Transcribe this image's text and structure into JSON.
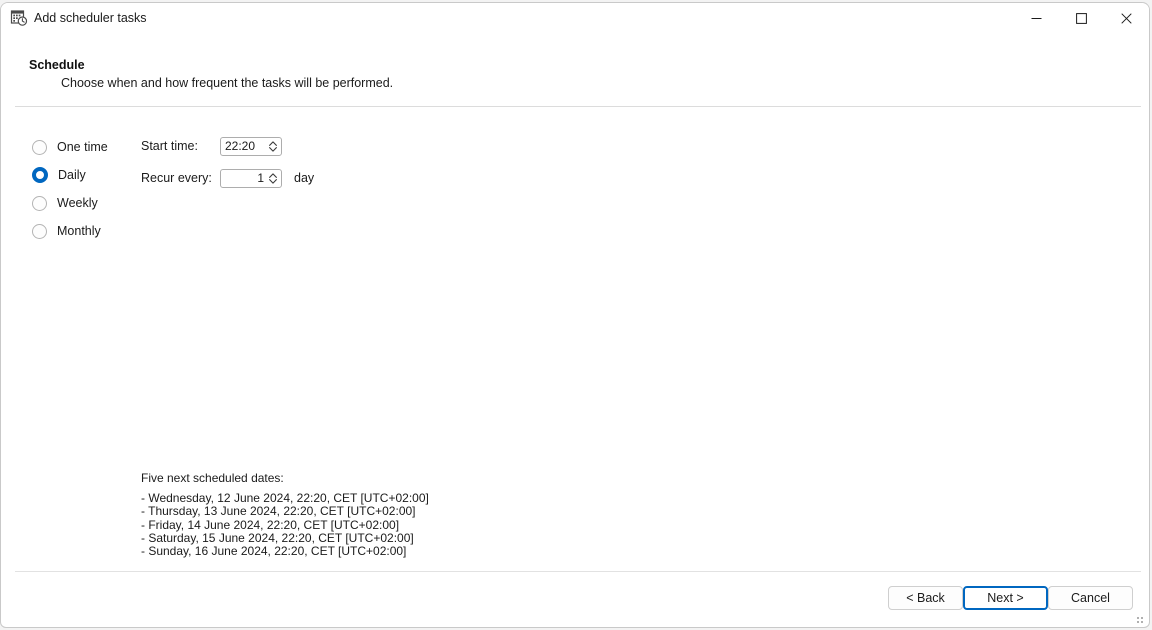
{
  "window": {
    "title": "Add scheduler tasks",
    "app_icon": "calendar-clock-icon",
    "controls": {
      "minimize": "minimize-icon",
      "maximize": "maximize-icon",
      "close": "close-icon"
    }
  },
  "header": {
    "title": "Schedule",
    "description": "Choose when and how frequent the tasks will be performed."
  },
  "recurrence": {
    "options": [
      {
        "label": "One time",
        "selected": false
      },
      {
        "label": "Daily",
        "selected": true
      },
      {
        "label": "Weekly",
        "selected": false
      },
      {
        "label": "Monthly",
        "selected": false
      }
    ],
    "selected_value": "Daily",
    "accent_color": "#0067c0"
  },
  "fields": {
    "start_time": {
      "label": "Start time:",
      "value": "22:20",
      "stepper_icon": "spinner-up-down-icon"
    },
    "recur_every": {
      "label": "Recur every:",
      "value": "1",
      "suffix": "day",
      "stepper_icon": "spinner-up-down-icon"
    }
  },
  "next_dates": {
    "title": "Five next scheduled dates:",
    "items": [
      "- Wednesday, 12 June 2024, 22:20, CET [UTC+02:00]",
      "- Thursday, 13 June 2024, 22:20, CET [UTC+02:00]",
      "- Friday, 14 June 2024, 22:20, CET [UTC+02:00]",
      "- Saturday, 15 June 2024, 22:20, CET [UTC+02:00]",
      "- Sunday, 16 June 2024, 22:20, CET [UTC+02:00]"
    ]
  },
  "footer": {
    "back_label": "< Back",
    "next_label": "Next >",
    "cancel_label": "Cancel",
    "default_button": "Next >"
  }
}
